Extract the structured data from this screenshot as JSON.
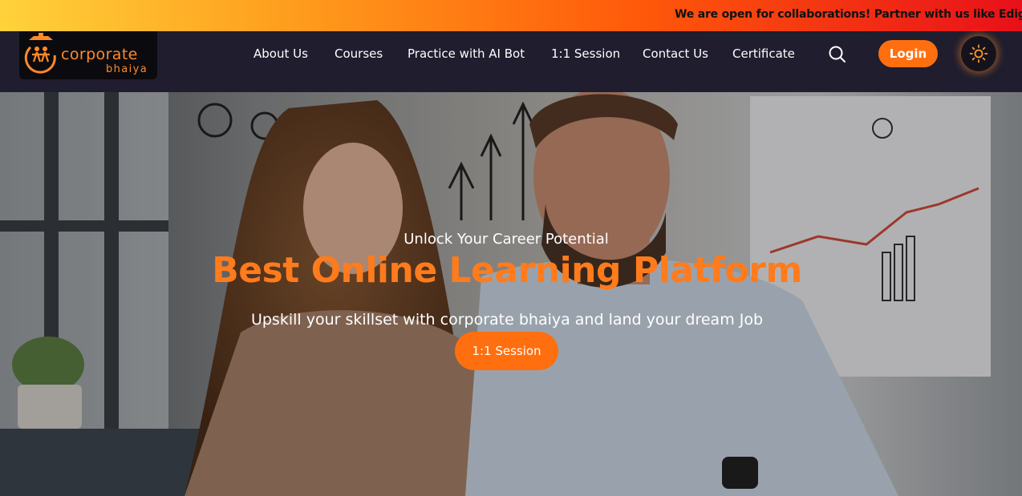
{
  "ticker": {
    "text": "We are open for collaborations! Partner with us like Edig"
  },
  "logo": {
    "line1": "corporate",
    "line2": "bhaiya",
    "icon": "logo-mark"
  },
  "nav": {
    "items": [
      {
        "label": "About Us"
      },
      {
        "label": "Courses"
      },
      {
        "label": "Practice with AI Bot"
      },
      {
        "label": "1:1 Session"
      },
      {
        "label": "Contact Us"
      },
      {
        "label": "Certificate"
      }
    ],
    "search_icon": "search-icon",
    "login_label": "Login",
    "theme_icon": "sun-icon"
  },
  "hero": {
    "eyebrow": "Unlock Your Career Potential",
    "title": "Best Online Learning Platform",
    "subtitle": "Upskill your skillset with corporate bhaiya and land your dream Job",
    "cta_label": "1:1 Session"
  },
  "colors": {
    "accent": "#ff6f0f",
    "title_orange": "#ff7b1c",
    "nav_bg": "#1f1d2e"
  }
}
